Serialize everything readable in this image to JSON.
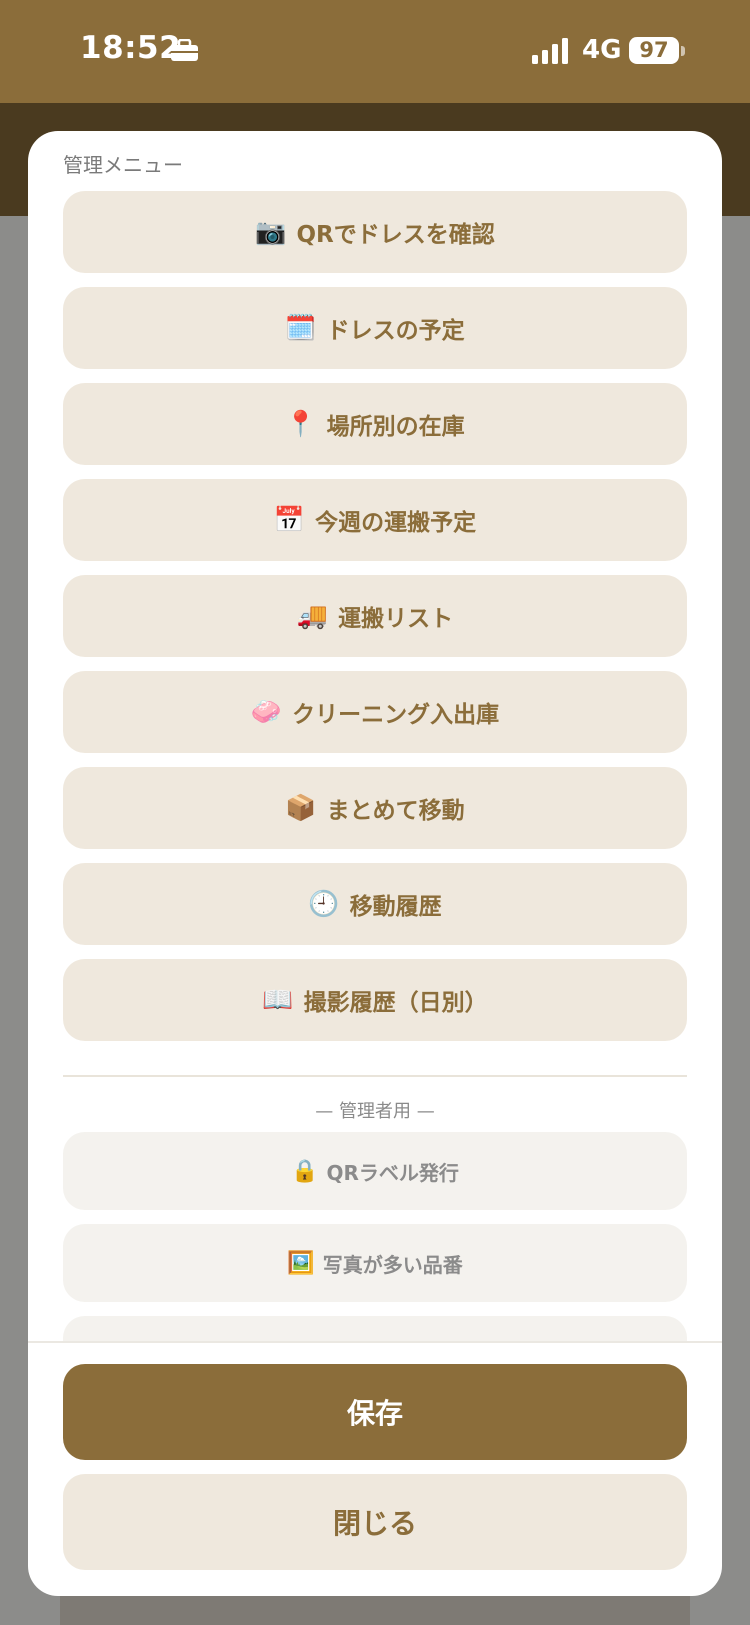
{
  "status_bar": {
    "time": "18:52",
    "network": "4G",
    "battery": "97"
  },
  "modal": {
    "title": "管理メニュー",
    "menu_items": [
      {
        "icon": "camera-icon",
        "emoji": "📷",
        "label": "QRでドレスを確認"
      },
      {
        "icon": "calendar-icon",
        "emoji": "🗓️",
        "label": "ドレスの予定"
      },
      {
        "icon": "pin-icon",
        "emoji": "📍",
        "label": "場所別の在庫"
      },
      {
        "icon": "calendar-icon",
        "emoji": "📅",
        "label": "今週の運搬予定"
      },
      {
        "icon": "truck-icon",
        "emoji": "🚚",
        "label": "運搬リスト"
      },
      {
        "icon": "soap-icon",
        "emoji": "🧼",
        "label": "クリーニング入出庫"
      },
      {
        "icon": "package-icon",
        "emoji": "📦",
        "label": "まとめて移動"
      },
      {
        "icon": "clock-icon",
        "emoji": "🕘",
        "label": "移動履歴"
      },
      {
        "icon": "book-icon",
        "emoji": "📖",
        "label": "撮影履歴（日別）"
      }
    ],
    "admin_section_label": "— 管理者用 —",
    "admin_items": [
      {
        "icon": "lock-icon",
        "emoji": "🔒",
        "label": "QRラベル発行"
      },
      {
        "icon": "picture-icon",
        "emoji": "🖼️",
        "label": "写真が多い品番"
      }
    ],
    "save_label": "保存",
    "close_label": "閉じる"
  },
  "colors": {
    "brand": "#8b6d3a",
    "header_dark": "#4a3a1f",
    "button_bg": "#efe8dd",
    "admin_bg": "#f4f2ee"
  }
}
